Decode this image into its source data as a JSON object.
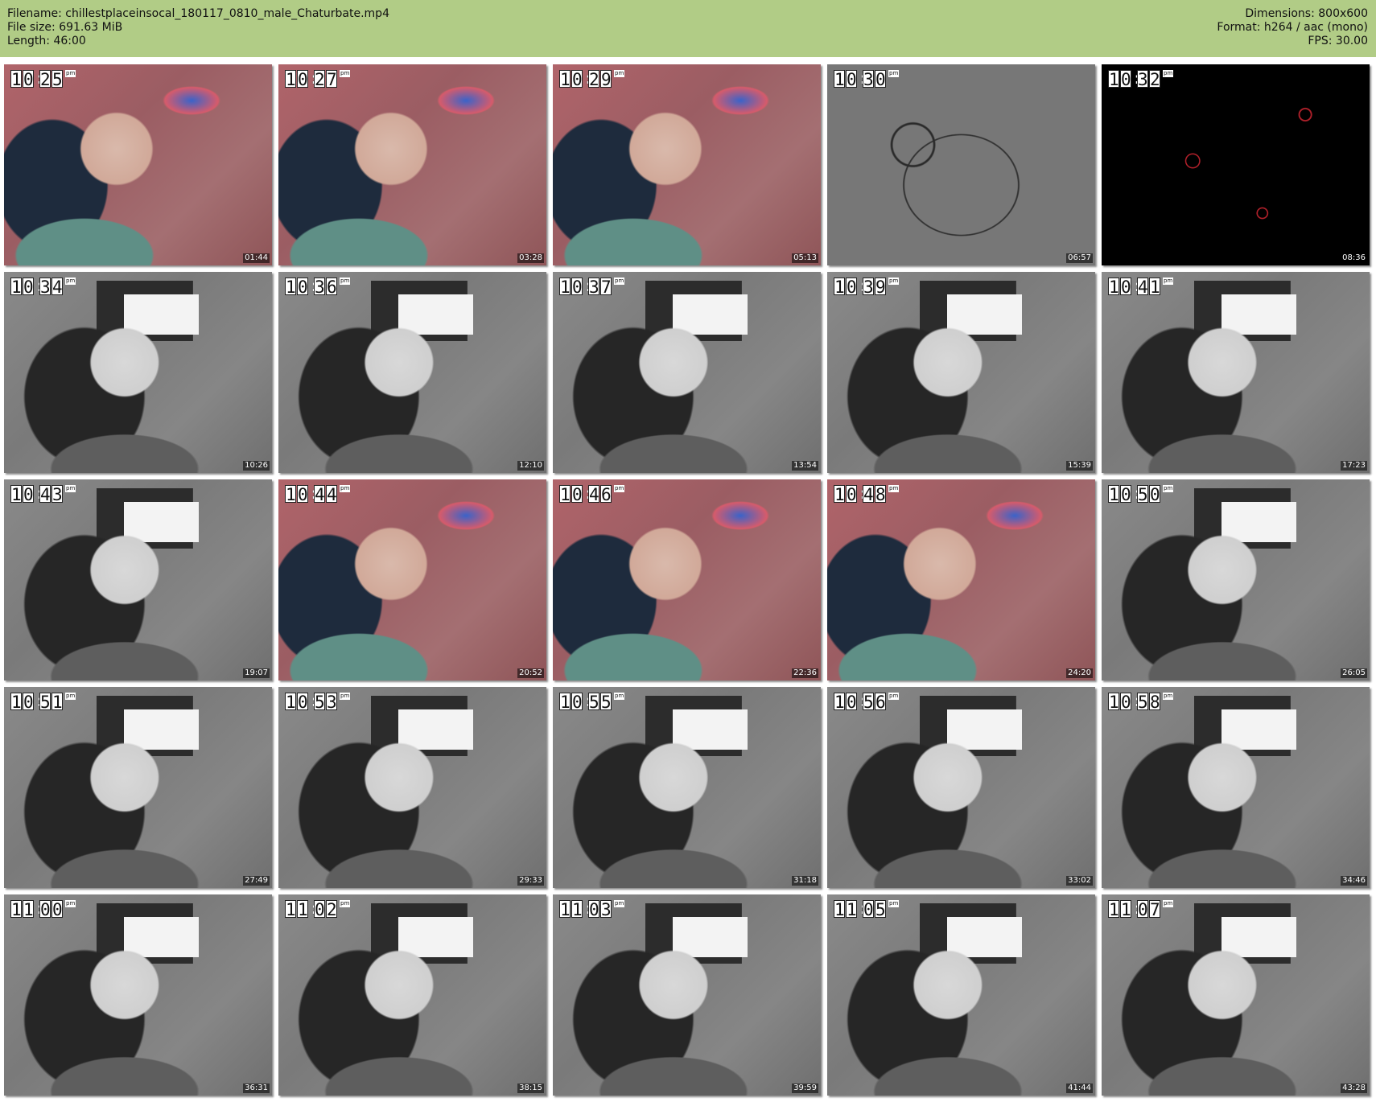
{
  "header": {
    "filename": "Filename: chillestplaceinsocal_180117_0810_male_Chaturbate.mp4",
    "filesize": "File size: 691.63 MiB",
    "length": "Length: 46:00",
    "dimensions": "Dimensions: 800x600",
    "format": "Format: h264 / aac (mono)",
    "fps": "FPS: 30.00"
  },
  "thumbnails": [
    {
      "clock": [
        "1",
        "0",
        "2",
        "5"
      ],
      "pm": "pm",
      "time": "01:44",
      "tone": "color"
    },
    {
      "clock": [
        "1",
        "0",
        "2",
        "7"
      ],
      "pm": "pm",
      "time": "03:28",
      "tone": "color"
    },
    {
      "clock": [
        "1",
        "0",
        "2",
        "9"
      ],
      "pm": "pm",
      "time": "05:13",
      "tone": "color"
    },
    {
      "clock": [
        "1",
        "0",
        "3",
        "0"
      ],
      "pm": "pm",
      "time": "06:57",
      "tone": "sketch"
    },
    {
      "clock": [
        "1",
        "0",
        "3",
        "2"
      ],
      "pm": "pm",
      "time": "08:36",
      "tone": "black"
    },
    {
      "clock": [
        "1",
        "0",
        "3",
        "4"
      ],
      "pm": "pm",
      "time": "10:26",
      "tone": "gray"
    },
    {
      "clock": [
        "1",
        "0",
        "3",
        "6"
      ],
      "pm": "pm",
      "time": "12:10",
      "tone": "gray"
    },
    {
      "clock": [
        "1",
        "0",
        "3",
        "7"
      ],
      "pm": "pm",
      "time": "13:54",
      "tone": "gray"
    },
    {
      "clock": [
        "1",
        "0",
        "3",
        "9"
      ],
      "pm": "pm",
      "time": "15:39",
      "tone": "gray"
    },
    {
      "clock": [
        "1",
        "0",
        "4",
        "1"
      ],
      "pm": "pm",
      "time": "17:23",
      "tone": "gray"
    },
    {
      "clock": [
        "1",
        "0",
        "4",
        "3"
      ],
      "pm": "pm",
      "time": "19:07",
      "tone": "gray"
    },
    {
      "clock": [
        "1",
        "0",
        "4",
        "4"
      ],
      "pm": "pm",
      "time": "20:52",
      "tone": "color"
    },
    {
      "clock": [
        "1",
        "0",
        "4",
        "6"
      ],
      "pm": "pm",
      "time": "22:36",
      "tone": "color"
    },
    {
      "clock": [
        "1",
        "0",
        "4",
        "8"
      ],
      "pm": "pm",
      "time": "24:20",
      "tone": "color"
    },
    {
      "clock": [
        "1",
        "0",
        "5",
        "0"
      ],
      "pm": "pm",
      "time": "26:05",
      "tone": "gray"
    },
    {
      "clock": [
        "1",
        "0",
        "5",
        "1"
      ],
      "pm": "pm",
      "time": "27:49",
      "tone": "gray"
    },
    {
      "clock": [
        "1",
        "0",
        "5",
        "3"
      ],
      "pm": "pm",
      "time": "29:33",
      "tone": "gray"
    },
    {
      "clock": [
        "1",
        "0",
        "5",
        "5"
      ],
      "pm": "pm",
      "time": "31:18",
      "tone": "gray"
    },
    {
      "clock": [
        "1",
        "0",
        "5",
        "6"
      ],
      "pm": "pm",
      "time": "33:02",
      "tone": "gray"
    },
    {
      "clock": [
        "1",
        "0",
        "5",
        "8"
      ],
      "pm": "pm",
      "time": "34:46",
      "tone": "gray"
    },
    {
      "clock": [
        "1",
        "1",
        "0",
        "0"
      ],
      "pm": "pm",
      "time": "36:31",
      "tone": "gray"
    },
    {
      "clock": [
        "1",
        "1",
        "0",
        "2"
      ],
      "pm": "pm",
      "time": "38:15",
      "tone": "gray"
    },
    {
      "clock": [
        "1",
        "1",
        "0",
        "3"
      ],
      "pm": "pm",
      "time": "39:59",
      "tone": "gray"
    },
    {
      "clock": [
        "1",
        "1",
        "0",
        "5"
      ],
      "pm": "pm",
      "time": "41:44",
      "tone": "gray"
    },
    {
      "clock": [
        "1",
        "1",
        "0",
        "7"
      ],
      "pm": "pm",
      "time": "43:28",
      "tone": "gray"
    }
  ]
}
